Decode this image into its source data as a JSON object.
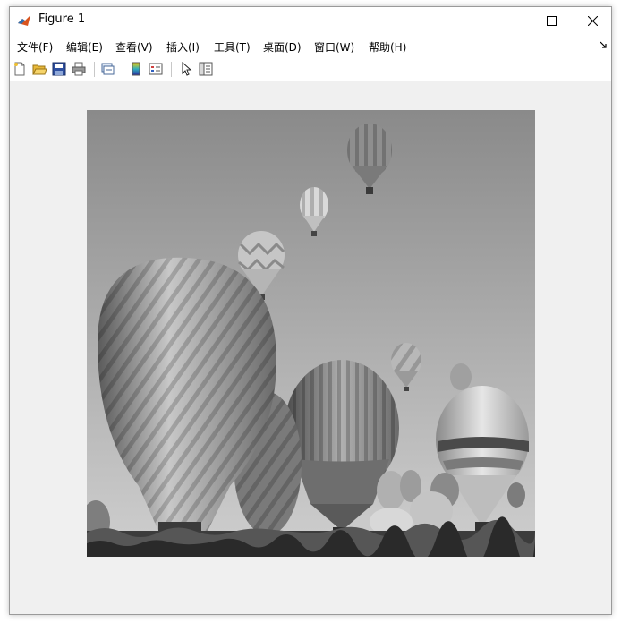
{
  "window": {
    "title": "Figure 1",
    "controls": [
      "minimize",
      "maximize",
      "close"
    ]
  },
  "menubar": {
    "items": [
      {
        "label": "文件(F)"
      },
      {
        "label": "编辑(E)"
      },
      {
        "label": "查看(V)"
      },
      {
        "label": "插入(I)"
      },
      {
        "label": "工具(T)"
      },
      {
        "label": "桌面(D)"
      },
      {
        "label": "窗口(W)"
      },
      {
        "label": "帮助(H)"
      }
    ]
  },
  "toolbar": {
    "buttons": [
      "new-figure-icon",
      "open-file-icon",
      "save-icon",
      "print-icon",
      "link-plot-icon",
      "insert-colorbar-icon",
      "insert-legend-icon",
      "edit-plot-arrow-icon",
      "property-inspector-icon"
    ]
  },
  "figure": {
    "content": "grayscale photograph of hot air balloons"
  },
  "colors": {
    "window_bg": "#f0f0f0",
    "titlebar_bg": "#ffffff",
    "sky_top": "#8a8a8a",
    "sky_bottom": "#cfcfcf"
  }
}
